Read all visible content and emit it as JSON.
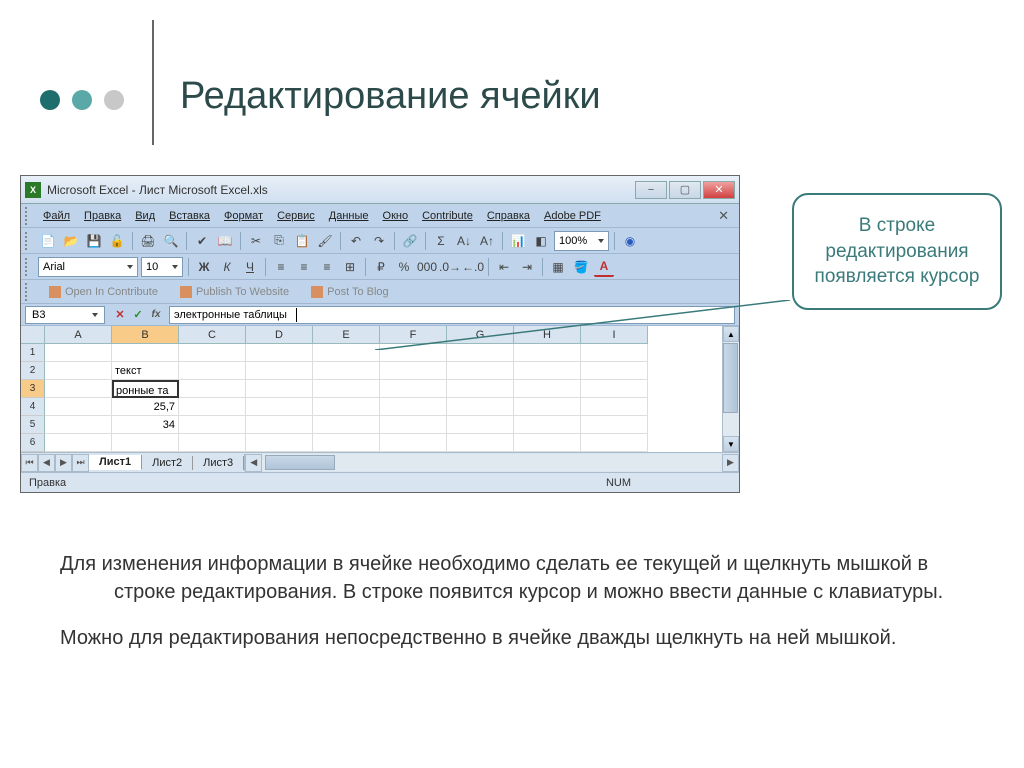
{
  "slide": {
    "title": "Редактирование ячейки",
    "callout": "В строке редактирования появляется курсор",
    "para1": "Для изменения информации в ячейке необходимо сделать ее текущей и щелкнуть мышкой в строке редактирования.  В строке появится курсор и можно ввести данные с клавиатуры.",
    "para2": "Можно для редактирования непосредственно в ячейке дважды щелкнуть на ней мышкой."
  },
  "excel": {
    "title": "Microsoft Excel - Лист Microsoft Excel.xls",
    "menus": [
      "Файл",
      "Правка",
      "Вид",
      "Вставка",
      "Формат",
      "Сервис",
      "Данные",
      "Окно",
      "Contribute",
      "Справка",
      "Adobe PDF"
    ],
    "font": "Arial",
    "fontsize": "10",
    "zoom": "100%",
    "contribute": [
      "Open In Contribute",
      "Publish To Website",
      "Post To Blog"
    ],
    "namebox": "B3",
    "formula": "электронные таблицы",
    "columns": [
      "A",
      "B",
      "C",
      "D",
      "E",
      "F",
      "G",
      "H",
      "I"
    ],
    "rows": [
      "1",
      "2",
      "3",
      "4",
      "5",
      "6"
    ],
    "cells": {
      "B2": "текст",
      "B3": "ронные та",
      "B4": "25,7",
      "B5": "34"
    },
    "sheets": [
      "Лист1",
      "Лист2",
      "Лист3"
    ],
    "status": "Правка",
    "num": "NUM"
  }
}
